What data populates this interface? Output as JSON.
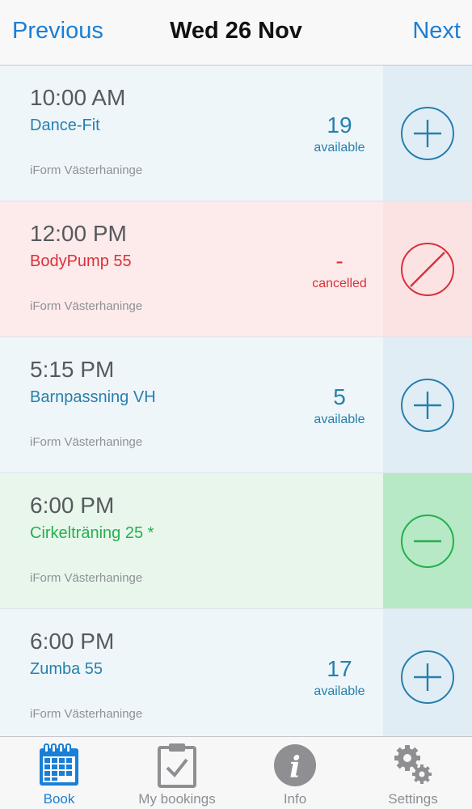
{
  "header": {
    "prev_label": "Previous",
    "title": "Wed 26 Nov",
    "next_label": "Next"
  },
  "colors": {
    "accent_blue": "#1a7fd6",
    "open_class": "#2680ad",
    "cancelled": "#d9313b",
    "booked": "#23b14d"
  },
  "classes": [
    {
      "time": "10:00 AM",
      "name": "Dance-Fit",
      "location": "iForm Västerhaninge",
      "count": "19",
      "status": "available",
      "state": "open",
      "action_icon": "plus-circle-icon"
    },
    {
      "time": "12:00 PM",
      "name": "BodyPump 55",
      "location": "iForm Västerhaninge",
      "count": "-",
      "status": "cancelled",
      "state": "cancelled",
      "action_icon": "no-entry-icon"
    },
    {
      "time": "5:15 PM",
      "name": "Barnpassning VH",
      "location": "iForm Västerhaninge",
      "count": "5",
      "status": "available",
      "state": "open",
      "action_icon": "plus-circle-icon"
    },
    {
      "time": "6:00 PM",
      "name": "Cirkelträning 25 *",
      "location": "iForm Västerhaninge",
      "count": "",
      "status": "",
      "state": "booked",
      "action_icon": "minus-circle-icon"
    },
    {
      "time": "6:00 PM",
      "name": "Zumba 55",
      "location": "iForm Västerhaninge",
      "count": "17",
      "status": "available",
      "state": "open",
      "action_icon": "plus-circle-icon"
    }
  ],
  "tabbar": {
    "items": [
      {
        "label": "Book",
        "icon": "calendar-icon",
        "active": true
      },
      {
        "label": "My bookings",
        "icon": "clipboard-check-icon",
        "active": false
      },
      {
        "label": "Info",
        "icon": "info-icon",
        "active": false
      },
      {
        "label": "Settings",
        "icon": "gears-icon",
        "active": false
      }
    ]
  }
}
